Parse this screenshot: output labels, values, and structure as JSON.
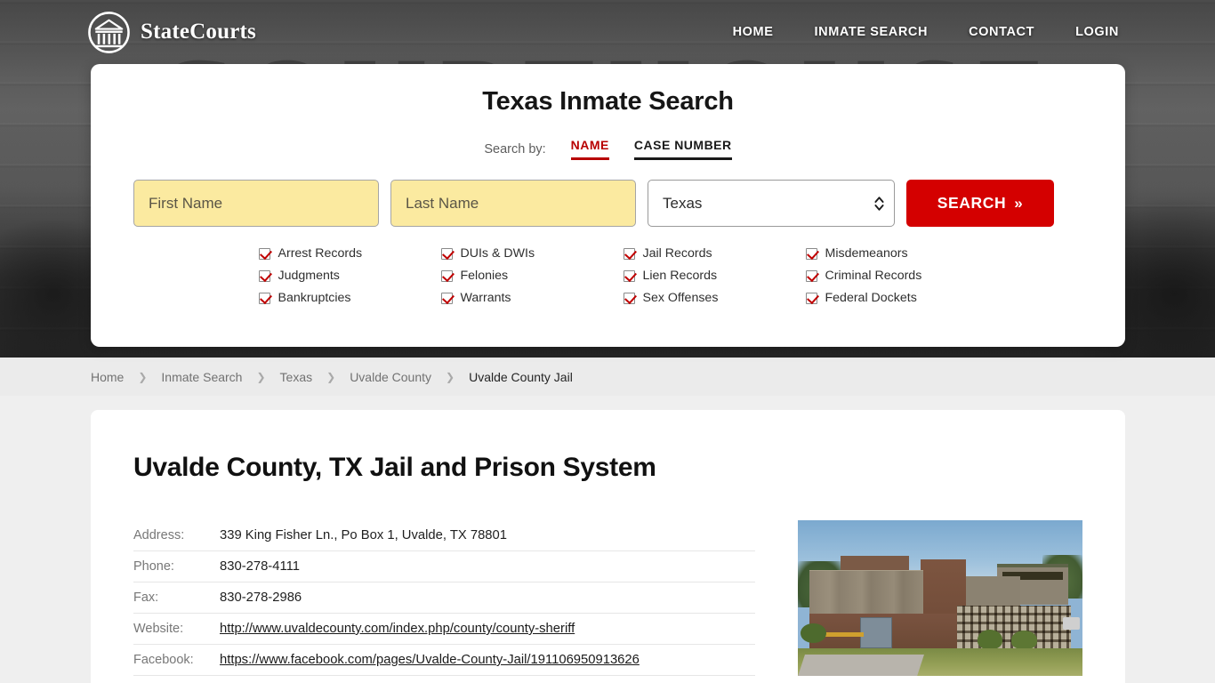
{
  "brand": {
    "name": "StateCourts",
    "logo_icon": "courthouse-circle-icon"
  },
  "nav": {
    "items": [
      {
        "label": "HOME"
      },
      {
        "label": "INMATE SEARCH"
      },
      {
        "label": "CONTACT"
      },
      {
        "label": "LOGIN"
      }
    ]
  },
  "hero": {
    "watermark": "COURTHOUSE"
  },
  "search": {
    "title": "Texas Inmate Search",
    "search_by_label": "Search by:",
    "tabs": [
      {
        "label": "NAME",
        "active": true
      },
      {
        "label": "CASE NUMBER",
        "active": false
      }
    ],
    "first_name_placeholder": "First Name",
    "first_name_value": "",
    "last_name_placeholder": "Last Name",
    "last_name_value": "",
    "state_selected": "Texas",
    "state_options": [
      "Texas"
    ],
    "button_label": "SEARCH",
    "button_chevron": "»",
    "accent_red": "#d40000",
    "tab_red": "#b80000",
    "field_yellow": "#fbeaa0",
    "checkboxes": [
      {
        "label": "Arrest Records"
      },
      {
        "label": "DUIs & DWIs"
      },
      {
        "label": "Jail Records"
      },
      {
        "label": "Misdemeanors"
      },
      {
        "label": "Judgments"
      },
      {
        "label": "Felonies"
      },
      {
        "label": "Lien Records"
      },
      {
        "label": "Criminal Records"
      },
      {
        "label": "Bankruptcies"
      },
      {
        "label": "Warrants"
      },
      {
        "label": "Sex Offenses"
      },
      {
        "label": "Federal Dockets"
      }
    ]
  },
  "breadcrumb": {
    "separator": "❯",
    "items": [
      {
        "label": "Home",
        "current": false
      },
      {
        "label": "Inmate Search",
        "current": false
      },
      {
        "label": "Texas",
        "current": false
      },
      {
        "label": "Uvalde County",
        "current": false
      },
      {
        "label": "Uvalde County Jail",
        "current": true
      }
    ]
  },
  "page": {
    "title": "Uvalde County, TX Jail and Prison System",
    "details": [
      {
        "label": "Address:",
        "value": "339 King Fisher Ln., Po Box 1, Uvalde, TX 78801",
        "is_link": false
      },
      {
        "label": "Phone:",
        "value": "830-278-4111",
        "is_link": false
      },
      {
        "label": "Fax:",
        "value": "830-278-2986",
        "is_link": false
      },
      {
        "label": "Website:",
        "value": "http://www.uvaldecounty.com/index.php/county/county-sheriff",
        "is_link": true
      },
      {
        "label": "Facebook:",
        "value": "https://www.facebook.com/pages/Uvalde-County-Jail/191106950913626",
        "is_link": true
      }
    ],
    "photo_alt": "Uvalde County Jail building exterior"
  }
}
